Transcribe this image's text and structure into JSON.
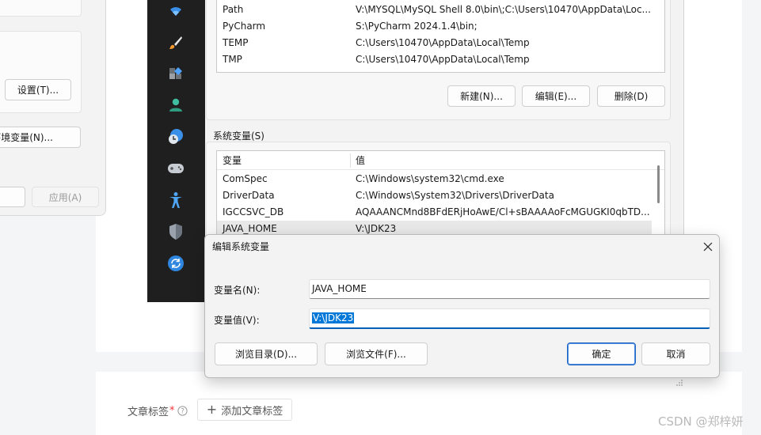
{
  "system_properties": {
    "settings_button": "设置(T)...",
    "env_vars_button": "环境变量(N)...",
    "apply_button": "应用(A)"
  },
  "sidebar_icons": [
    "wifi-icon",
    "paintbrush-icon",
    "apps-icon",
    "account-icon",
    "time-language-icon",
    "gaming-icon",
    "accessibility-icon",
    "privacy-shield-icon",
    "windows-update-icon"
  ],
  "user_vars": {
    "rows": [
      {
        "name": "Path",
        "value": "V:\\MYSQL\\MySQL Shell 8.0\\bin\\;C:\\Users\\10470\\AppData\\Loc..."
      },
      {
        "name": "PyCharm",
        "value": "S:\\PyCharm 2024.1.4\\bin;"
      },
      {
        "name": "TEMP",
        "value": "C:\\Users\\10470\\AppData\\Local\\Temp"
      },
      {
        "name": "TMP",
        "value": "C:\\Users\\10470\\AppData\\Local\\Temp"
      }
    ],
    "new_button": "新建(N)...",
    "edit_button": "编辑(E)...",
    "delete_button": "删除(D)"
  },
  "system_vars": {
    "group_label": "系统变量(S)",
    "col_variable": "变量",
    "col_value": "值",
    "rows": [
      {
        "name": "ComSpec",
        "value": "C:\\Windows\\system32\\cmd.exe"
      },
      {
        "name": "DriverData",
        "value": "C:\\Windows\\System32\\Drivers\\DriverData"
      },
      {
        "name": "IGCCSVC_DB",
        "value": "AQAAANCMnd8BFdERjHoAwE/Cl+sBAAAAoFcMGUGKI0qbTD..."
      },
      {
        "name": "JAVA_HOME",
        "value": "V:\\JDK23"
      }
    ]
  },
  "edit_dialog": {
    "title": "编辑系统变量",
    "name_label": "变量名(N):",
    "name_value": "JAVA_HOME",
    "value_label": "变量值(V):",
    "value_value": "V:\\JDK23",
    "browse_dir_button": "浏览目录(D)...",
    "browse_file_button": "浏览文件(F)...",
    "ok_button": "确定",
    "cancel_button": "取消"
  },
  "blog": {
    "tags_label": "文章标签",
    "required_mark": "*",
    "add_tag_button": "添加文章标签"
  },
  "watermark": "CSDN @郑梓妍"
}
